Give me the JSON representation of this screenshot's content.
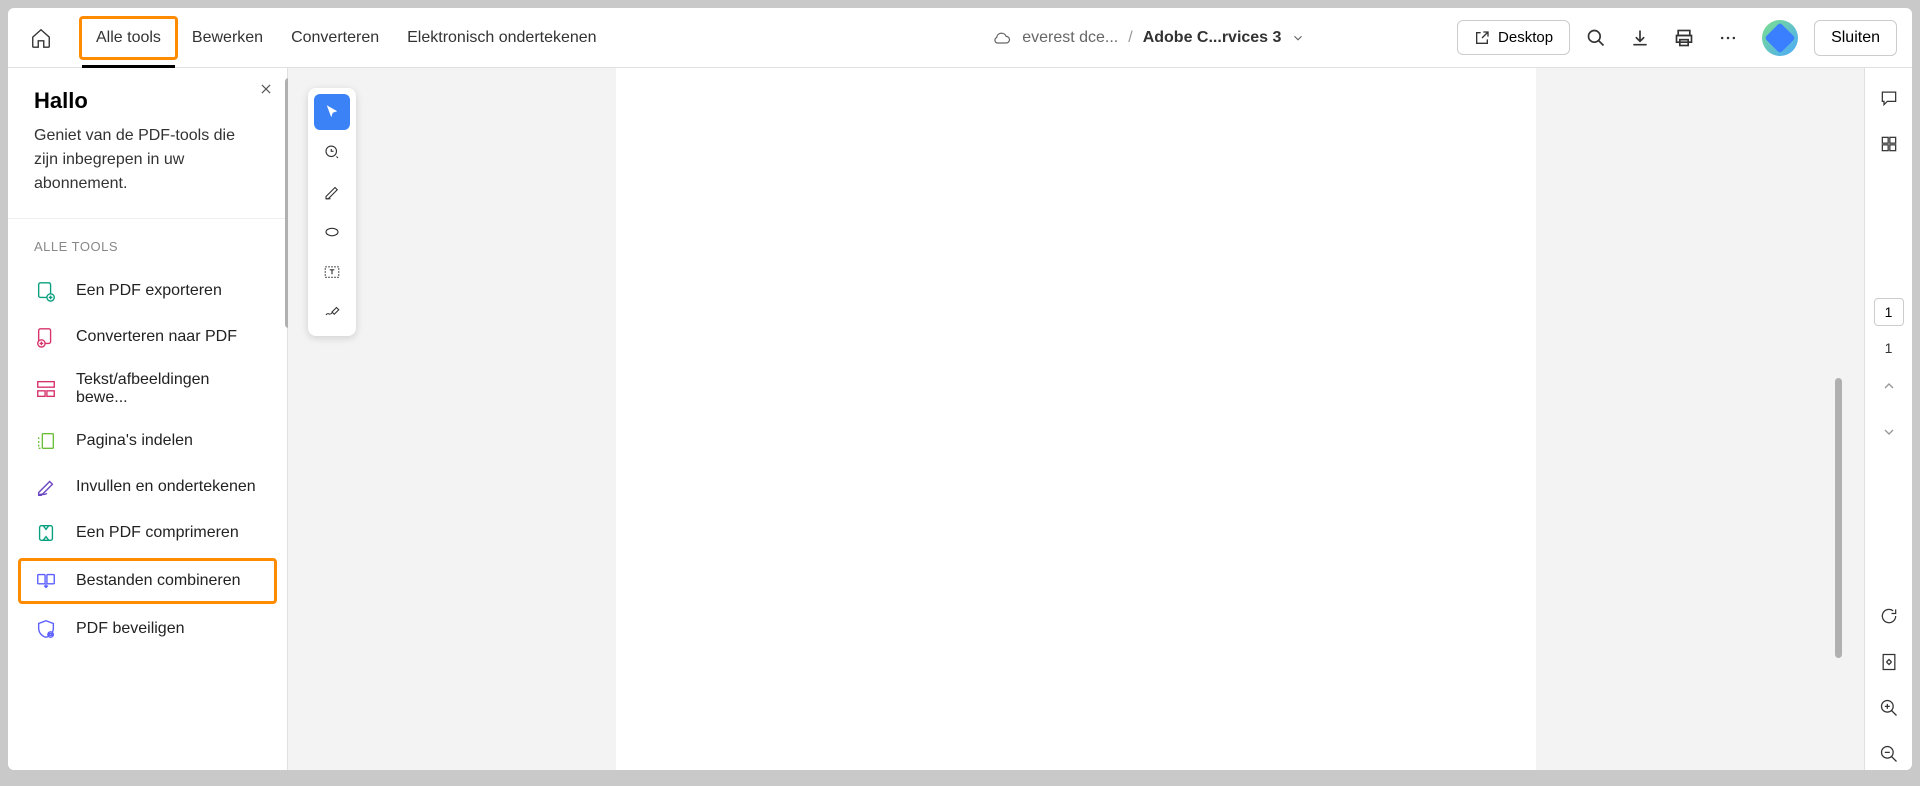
{
  "topbar": {
    "nav": [
      "Alle tools",
      "Bewerken",
      "Converteren",
      "Elektronisch ondertekenen"
    ],
    "breadcrumb_file": "everest dce...",
    "breadcrumb_sep": "/",
    "breadcrumb_current": "Adobe C...rvices 3",
    "desktop_label": "Desktop",
    "close_label": "Sluiten"
  },
  "sidebar": {
    "title": "Hallo",
    "subtitle": "Geniet van de PDF-tools die zijn inbegrepen in uw abonnement.",
    "section_label": "ALLE TOOLS",
    "tools": [
      "Een PDF exporteren",
      "Converteren naar PDF",
      "Tekst/afbeeldingen bewe...",
      "Pagina's indelen",
      "Invullen en ondertekenen",
      "Een PDF comprimeren",
      "Bestanden combineren",
      "PDF beveiligen"
    ]
  },
  "right_rail": {
    "page_input": "1",
    "page_total": "1"
  }
}
